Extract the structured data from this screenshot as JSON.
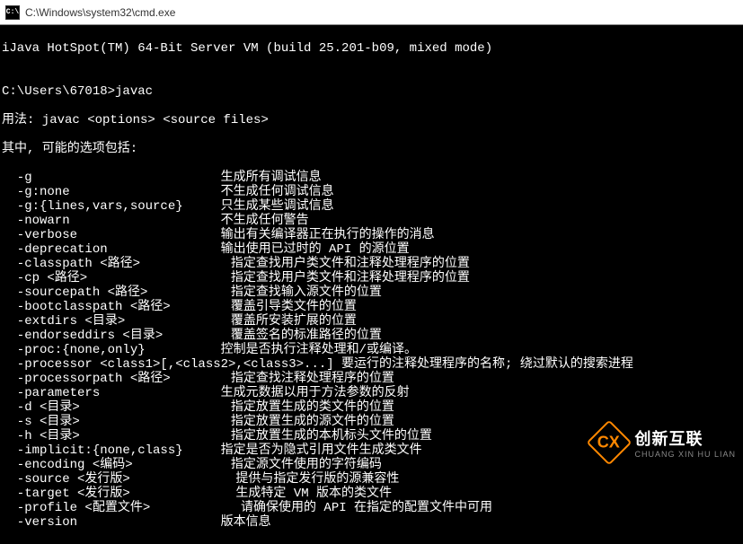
{
  "window": {
    "icon_label": "C:\\",
    "title": "C:\\Windows\\system32\\cmd.exe"
  },
  "terminal": {
    "header_line": "iJava HotSpot(TM) 64-Bit Server VM (build 25.201-b09, mixed mode)",
    "blank": "",
    "prompt_line": "C:\\Users\\67018>javac",
    "usage_line": "用法: javac <options> <source files>",
    "intro_line": "其中, 可能的选项包括:",
    "options": [
      {
        "flag": "  -g                         ",
        "desc": "生成所有调试信息"
      },
      {
        "flag": "  -g:none                    ",
        "desc": "不生成任何调试信息"
      },
      {
        "flag": "  -g:{lines,vars,source}     ",
        "desc": "只生成某些调试信息"
      },
      {
        "flag": "  -nowarn                    ",
        "desc": "不生成任何警告"
      },
      {
        "flag": "  -verbose                   ",
        "desc": "输出有关编译器正在执行的操作的消息"
      },
      {
        "flag": "  -deprecation               ",
        "desc": "输出使用已过时的 API 的源位置"
      },
      {
        "flag": "  -classpath <路径>            ",
        "desc": "指定查找用户类文件和注释处理程序的位置"
      },
      {
        "flag": "  -cp <路径>                   ",
        "desc": "指定查找用户类文件和注释处理程序的位置"
      },
      {
        "flag": "  -sourcepath <路径>           ",
        "desc": "指定查找输入源文件的位置"
      },
      {
        "flag": "  -bootclasspath <路径>        ",
        "desc": "覆盖引导类文件的位置"
      },
      {
        "flag": "  -extdirs <目录>              ",
        "desc": "覆盖所安装扩展的位置"
      },
      {
        "flag": "  -endorseddirs <目录>         ",
        "desc": "覆盖签名的标准路径的位置"
      },
      {
        "flag": "  -proc:{none,only}          ",
        "desc": "控制是否执行注释处理和/或编译。"
      },
      {
        "flag": "  -processor <class1>[,<class2>,<class3>...] ",
        "desc": "要运行的注释处理程序的名称; 绕过默认的搜索进程"
      },
      {
        "flag": "  -processorpath <路径>        ",
        "desc": "指定查找注释处理程序的位置"
      },
      {
        "flag": "  -parameters                ",
        "desc": "生成元数据以用于方法参数的反射"
      },
      {
        "flag": "  -d <目录>                    ",
        "desc": "指定放置生成的类文件的位置"
      },
      {
        "flag": "  -s <目录>                    ",
        "desc": "指定放置生成的源文件的位置"
      },
      {
        "flag": "  -h <目录>                    ",
        "desc": "指定放置生成的本机标头文件的位置"
      },
      {
        "flag": "  -implicit:{none,class}     ",
        "desc": "指定是否为隐式引用文件生成类文件"
      },
      {
        "flag": "  -encoding <编码>             ",
        "desc": "指定源文件使用的字符编码"
      },
      {
        "flag": "  -source <发行版>              ",
        "desc": "提供与指定发行版的源兼容性"
      },
      {
        "flag": "  -target <发行版>              ",
        "desc": "生成特定 VM 版本的类文件"
      },
      {
        "flag": "  -profile <配置文件>            ",
        "desc": "请确保使用的 API 在指定的配置文件中可用"
      },
      {
        "flag": "  -version                   ",
        "desc": "版本信息"
      }
    ]
  },
  "watermark": {
    "icon_text": "CX",
    "text_cn": "创新互联",
    "text_en": "CHUANG XIN HU LIAN"
  }
}
